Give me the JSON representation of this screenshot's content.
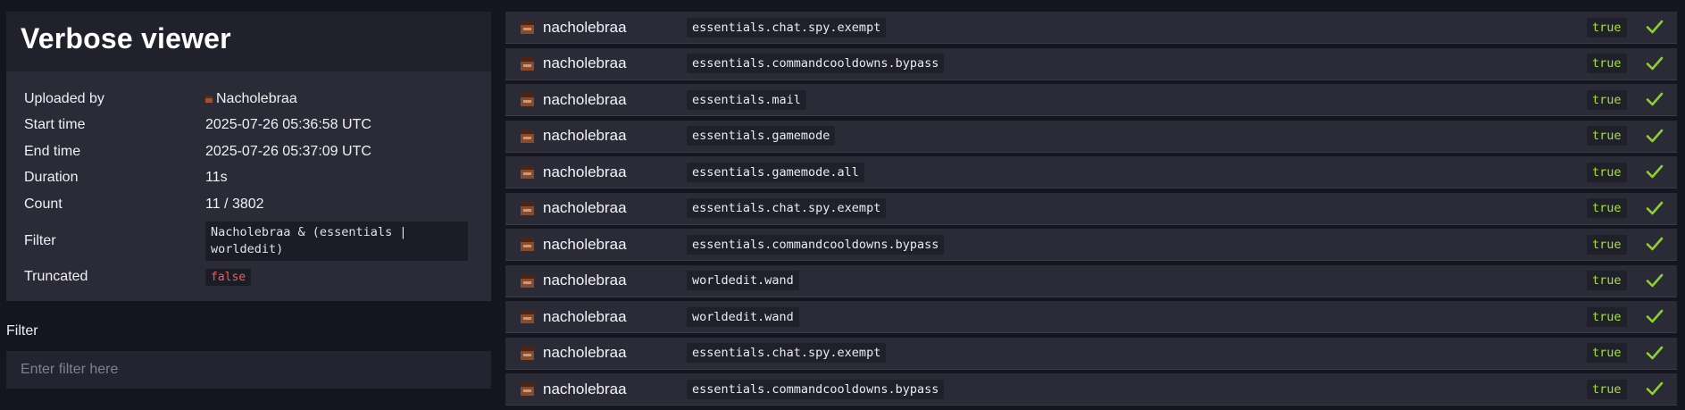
{
  "viewer": {
    "title": "Verbose viewer",
    "details": {
      "uploaded_by_label": "Uploaded by",
      "uploaded_by": "Nacholebraa",
      "start_time_label": "Start time",
      "start_time": "2025-07-26 05:36:58 UTC",
      "end_time_label": "End time",
      "end_time": "2025-07-26 05:37:09 UTC",
      "duration_label": "Duration",
      "duration": "11s",
      "count_label": "Count",
      "count": "11 / 3802",
      "filter_label": "Filter",
      "filter": "Nacholebraa & (essentials | worldedit)",
      "truncated_label": "Truncated",
      "truncated": "false"
    }
  },
  "filter_section": {
    "label": "Filter",
    "placeholder": "Enter filter here",
    "value": ""
  },
  "entries": [
    {
      "user": "nacholebraa",
      "permission": "essentials.chat.spy.exempt",
      "result": "true"
    },
    {
      "user": "nacholebraa",
      "permission": "essentials.commandcooldowns.bypass",
      "result": "true"
    },
    {
      "user": "nacholebraa",
      "permission": "essentials.mail",
      "result": "true"
    },
    {
      "user": "nacholebraa",
      "permission": "essentials.gamemode",
      "result": "true"
    },
    {
      "user": "nacholebraa",
      "permission": "essentials.gamemode.all",
      "result": "true"
    },
    {
      "user": "nacholebraa",
      "permission": "essentials.chat.spy.exempt",
      "result": "true"
    },
    {
      "user": "nacholebraa",
      "permission": "essentials.commandcooldowns.bypass",
      "result": "true"
    },
    {
      "user": "nacholebraa",
      "permission": "worldedit.wand",
      "result": "true"
    },
    {
      "user": "nacholebraa",
      "permission": "worldedit.wand",
      "result": "true"
    },
    {
      "user": "nacholebraa",
      "permission": "essentials.chat.spy.exempt",
      "result": "true"
    },
    {
      "user": "nacholebraa",
      "permission": "essentials.commandcooldowns.bypass",
      "result": "true"
    }
  ],
  "icons": {
    "entry_avatar": "player-head-icon",
    "entry_status": "checkmark-icon",
    "uploader_avatar": "player-head-icon"
  },
  "colors": {
    "true_text": "#a6e22e",
    "false_text": "#f25c5c",
    "check": "#8ed12f"
  }
}
